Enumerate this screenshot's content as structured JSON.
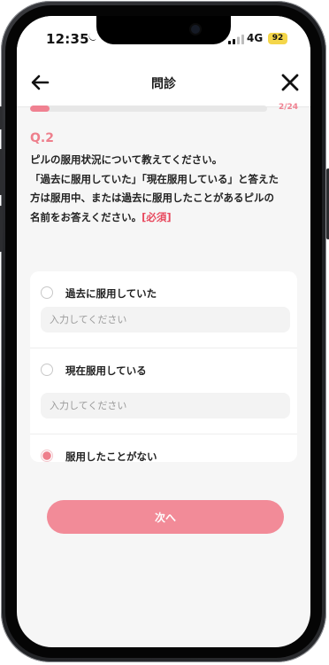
{
  "status": {
    "time": "12:35",
    "network": "4G",
    "battery": "92"
  },
  "header": {
    "title": "問診"
  },
  "progress": {
    "current": 2,
    "total": 24,
    "label": "2/24",
    "fill_fraction": 0.083
  },
  "question": {
    "number": "Q.2",
    "lines": [
      "ピルの服用状況について教えてください。",
      "「過去に服用していた」「現在服用している」と答えた",
      "方は服用中、または過去に服用したことがあるピルの",
      "名前をお答えください。"
    ],
    "required": "[必須]"
  },
  "options": [
    {
      "label": "過去に服用していた",
      "placeholder": "入力してください",
      "selected": false
    },
    {
      "label": "現在服用している",
      "placeholder": "入力してください",
      "selected": false
    },
    {
      "label": "服用したことがない",
      "selected": true
    }
  ],
  "next_button": {
    "label": "次へ"
  },
  "colors": {
    "accent": "#ee7f8c",
    "required": "#e84a5f",
    "button": "#f28b98"
  }
}
